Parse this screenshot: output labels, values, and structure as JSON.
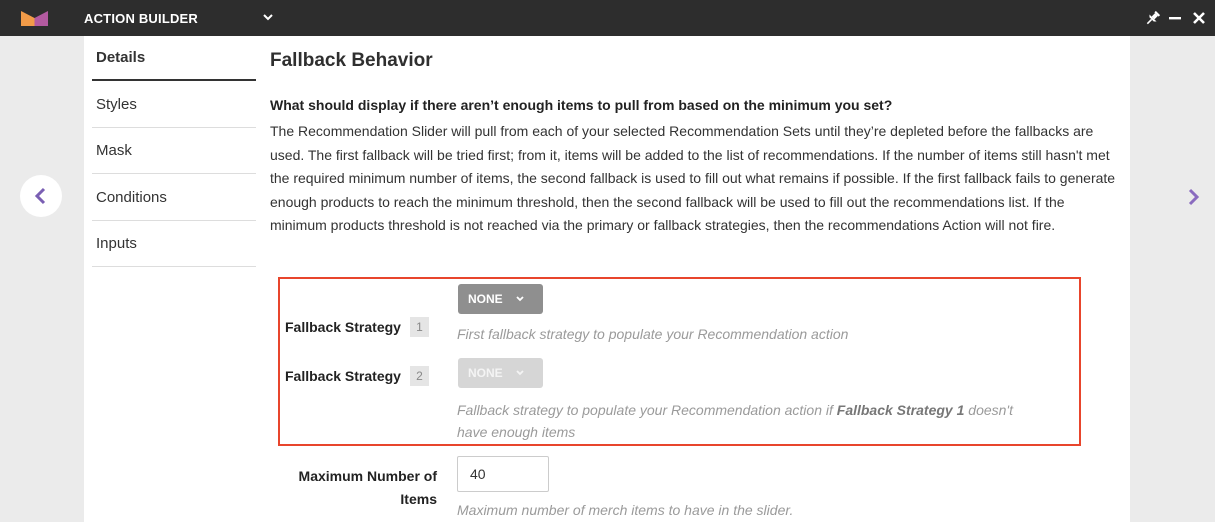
{
  "app": {
    "title": "ACTION BUILDER",
    "brand_colors": [
      "#f29b48",
      "#b35aa0"
    ],
    "icons": {
      "logo": "brand-logo",
      "title_dropdown": "chevron-down-icon",
      "pin": "pin-icon",
      "minimize": "minimize-icon",
      "close": "close-icon",
      "prev": "chevron-left-icon",
      "next": "chevron-right-icon"
    }
  },
  "nav": {
    "items": [
      {
        "label": "Details",
        "active": true
      },
      {
        "label": "Styles",
        "active": false
      },
      {
        "label": "Mask",
        "active": false
      },
      {
        "label": "Conditions",
        "active": false
      },
      {
        "label": "Inputs",
        "active": false
      }
    ]
  },
  "content": {
    "section_title": "Fallback Behavior",
    "question": "What should display if there aren’t enough items to pull from based on the minimum you set?",
    "description": "The Recommendation Slider will pull from each of your selected Recommendation Sets until they’re depleted before the fallbacks are used. The first fallback will be tried first; from it, items will be added to the list of recommendations. If the number of items still hasn't met the required minimum number of items, the second fallback is used to fill out what remains if possible. If the first fallback fails to generate enough products to reach the minimum threshold, then the second fallback will be used to fill out the recommendations list. If the minimum products threshold is not reached via the primary or fallback strategies, then the recommendations Action will not fire."
  },
  "fallbacks": [
    {
      "label": "Fallback Strategy",
      "badge": "1",
      "value": "NONE",
      "enabled": true,
      "help": "First fallback strategy to populate your Recommendation action"
    },
    {
      "label": "Fallback Strategy",
      "badge": "2",
      "value": "NONE",
      "enabled": false,
      "help_prefix": "Fallback strategy to populate your Recommendation action if ",
      "help_strong": "Fallback Strategy 1",
      "help_suffix": " doesn't",
      "help_line2": "have enough items"
    }
  ],
  "max_items": {
    "label_line1": "Maximum Number of",
    "label_line2": "Items",
    "value": "40",
    "help": "Maximum number of merch items to have in the slider."
  },
  "colors": {
    "highlight": "#e8452c",
    "topbar": "#2d2d2d",
    "next_arrow": "#8a6bbf"
  }
}
